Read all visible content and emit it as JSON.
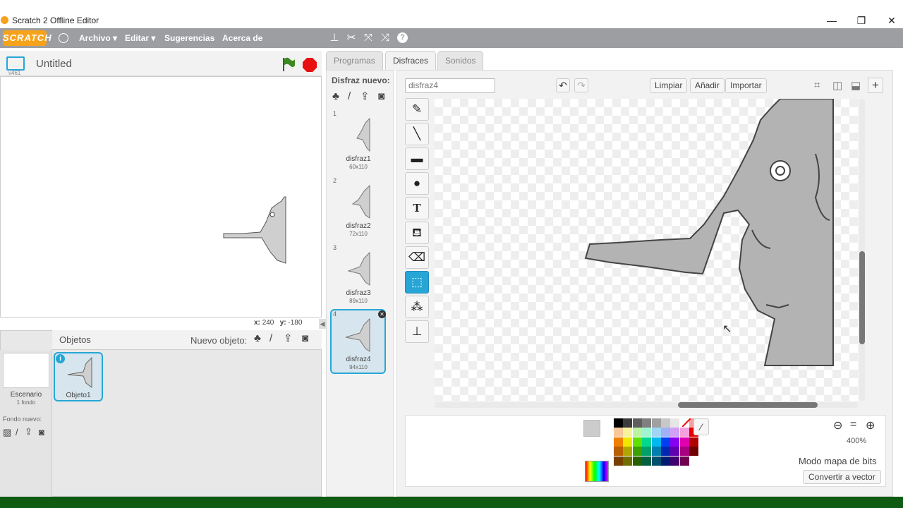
{
  "window": {
    "title": "Scratch 2 Offline Editor",
    "min": "—",
    "max": "❐",
    "close": "✕"
  },
  "menubar": {
    "logo": "SCRATCH",
    "items": [
      "Archivo ▾",
      "Editar ▾",
      "Sugerencias",
      "Acerca de"
    ]
  },
  "stage": {
    "project_title": "Untitled",
    "version": "v461",
    "coords": {
      "x_label": "x:",
      "x": "240",
      "y_label": "y:",
      "y": "-180"
    }
  },
  "sprites": {
    "objects_label": "Objetos",
    "new_object_label": "Nuevo objeto:",
    "stage_name": "Escenario",
    "stage_sub": "1 fondo",
    "new_bg_label": "Fondo nuevo:",
    "sprite_name": "Objeto1"
  },
  "tabs": [
    "Programas",
    "Disfraces",
    "Sonidos"
  ],
  "costumes": {
    "new_label": "Disfraz nuevo:",
    "items": [
      {
        "num": "1",
        "name": "disfraz1",
        "size": "60x110"
      },
      {
        "num": "2",
        "name": "disfraz2",
        "size": "72x110"
      },
      {
        "num": "3",
        "name": "disfraz3",
        "size": "89x110"
      },
      {
        "num": "4",
        "name": "disfraz4",
        "size": "94x110"
      }
    ]
  },
  "editor": {
    "costume_name": "disfraz4",
    "clear": "Limpiar",
    "add": "Añadir",
    "import": "Importar",
    "zoom": "400%",
    "mode": "Modo mapa de bits",
    "convert": "Convertir a vector"
  },
  "palette": [
    "#000000",
    "#3c3c3c",
    "#5f5f5f",
    "#7f7f7f",
    "#a0a0a0",
    "#c8c8c8",
    "#e6e6e6",
    "#ffffff",
    "#f4a0a0",
    "#f7c99a",
    "#f7f39c",
    "#baf4a0",
    "#a0f4d2",
    "#a0d6f4",
    "#a0b0f4",
    "#d2a0f4",
    "#f4a0dc",
    "#e80000",
    "#f08000",
    "#f0e800",
    "#60e000",
    "#00d890",
    "#00b8f0",
    "#0040f0",
    "#8800f0",
    "#e000b0",
    "#b00000",
    "#b86000",
    "#b0a800",
    "#3ca000",
    "#00a068",
    "#0080b0",
    "#0028b0",
    "#6000b0",
    "#a80080",
    "#700000",
    "#784000",
    "#707000",
    "#286000",
    "#006040",
    "#005070",
    "#001c70",
    "#400070",
    "#700050"
  ],
  "colors": {
    "accent": "#27a6d6",
    "menubar": "#9c9ea2",
    "logo": "#f7a21b"
  }
}
